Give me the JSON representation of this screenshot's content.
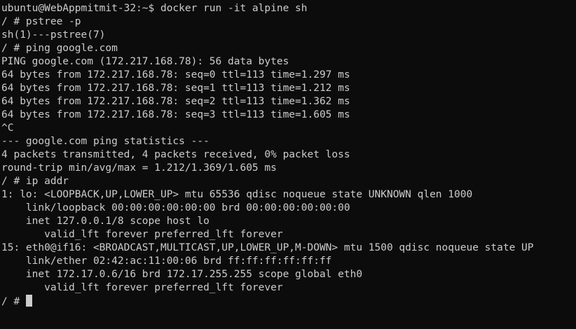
{
  "terminal": {
    "lines": [
      "ubuntu@WebAppmitmit-32:~$ docker run -it alpine sh",
      "/ # pstree -p",
      "sh(1)---pstree(7)",
      "/ # ping google.com",
      "PING google.com (172.217.168.78): 56 data bytes",
      "64 bytes from 172.217.168.78: seq=0 ttl=113 time=1.297 ms",
      "64 bytes from 172.217.168.78: seq=1 ttl=113 time=1.212 ms",
      "64 bytes from 172.217.168.78: seq=2 ttl=113 time=1.362 ms",
      "64 bytes from 172.217.168.78: seq=3 ttl=113 time=1.605 ms",
      "^C",
      "--- google.com ping statistics ---",
      "4 packets transmitted, 4 packets received, 0% packet loss",
      "round-trip min/avg/max = 1.212/1.369/1.605 ms",
      "/ # ip addr",
      "1: lo: <LOOPBACK,UP,LOWER_UP> mtu 65536 qdisc noqueue state UNKNOWN qlen 1000",
      "    link/loopback 00:00:00:00:00:00 brd 00:00:00:00:00:00",
      "    inet 127.0.0.1/8 scope host lo",
      "       valid_lft forever preferred_lft forever",
      "15: eth0@if16: <BROADCAST,MULTICAST,UP,LOWER_UP,M-DOWN> mtu 1500 qdisc noqueue state UP",
      "    link/ether 02:42:ac:11:00:06 brd ff:ff:ff:ff:ff:ff",
      "    inet 172.17.0.6/16 brd 172.17.255.255 scope global eth0",
      "       valid_lft forever preferred_lft forever"
    ],
    "prompt": "/ # "
  },
  "colors": {
    "background": "#0c0c0c",
    "foreground": "#cccccc"
  }
}
